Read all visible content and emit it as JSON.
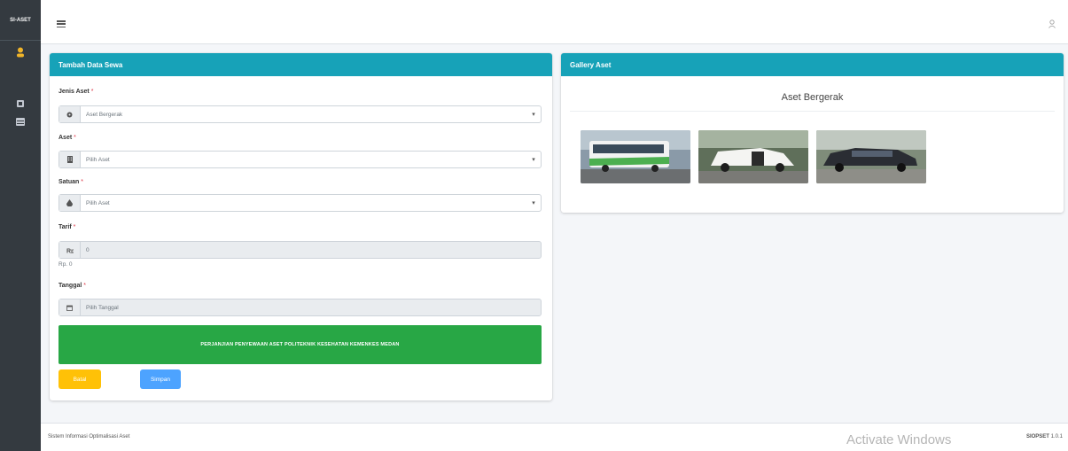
{
  "app": {
    "brand": "SI-ASET"
  },
  "form": {
    "header": "Tambah Data Sewa",
    "jenis_aset": {
      "label": "Jenis Aset",
      "required": "*",
      "value": "Aset Bergerak"
    },
    "aset": {
      "label": "Aset",
      "required": "*",
      "value": "Pilih Aset"
    },
    "satuan": {
      "label": "Satuan",
      "required": "*",
      "value": "Pilih Aset"
    },
    "tarif": {
      "label": "Tarif",
      "required": "*",
      "value": "0",
      "helper": "Rp. 0"
    },
    "tanggal": {
      "label": "Tanggal",
      "required": "*",
      "placeholder": "Pilih Tanggal"
    },
    "agreement_label": "PERJANJIAN PENYEWAAN ASET POLITEKNIK KESEHATAN KEMENKES MEDAN",
    "batal_label": "Batal",
    "simpan_label": "Simpan"
  },
  "gallery": {
    "header": "Gallery Aset",
    "title": "Aset Bergerak"
  },
  "footer": {
    "left": "Sistem Informasi Optimalisasi Aset",
    "right_brand": "SIOPSET",
    "right_version": "1.0.1"
  },
  "watermark": "Activate Windows",
  "colors": {
    "info": "#17a2b8",
    "success": "#28a745",
    "warning": "#ffc107",
    "primary": "#4da3ff",
    "sidebar": "#343a40"
  }
}
